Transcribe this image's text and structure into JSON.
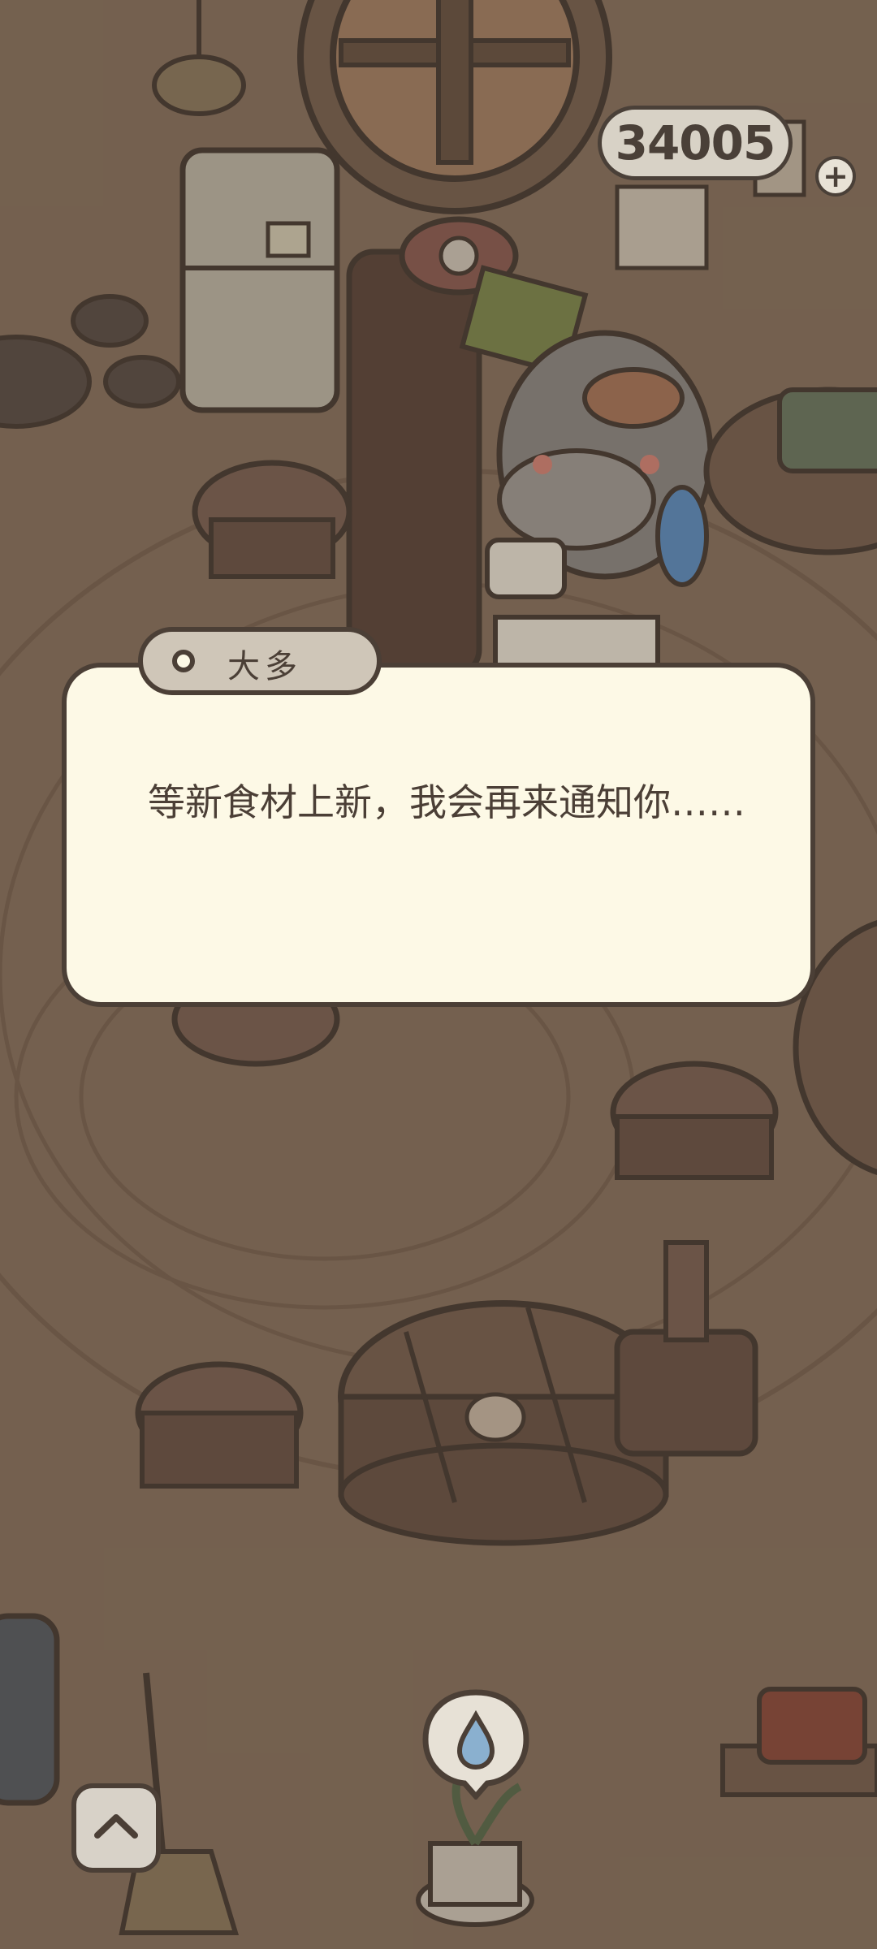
{
  "hud": {
    "coins": "34005",
    "add_icon": "plus-icon"
  },
  "dialog": {
    "speaker": "大多",
    "text": "等新食材上新，我会再来通知你……"
  },
  "controls": {
    "expand_icon": "chevron-up-icon",
    "water_hint_icon": "water-drop-icon"
  },
  "colors": {
    "background": "#8a7460",
    "dialog_fill": "#fdf9e6",
    "outline": "#4b3f36",
    "name_tag": "#cfc6b8"
  }
}
